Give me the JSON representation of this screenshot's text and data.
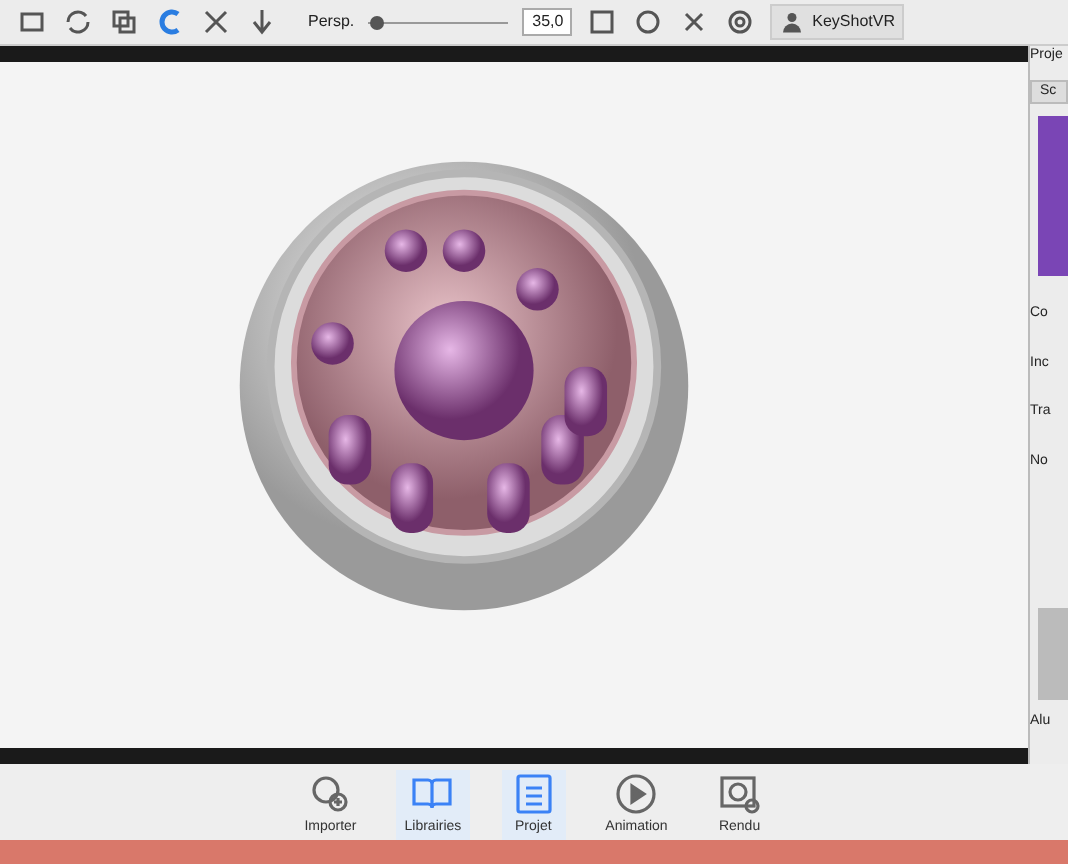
{
  "toolbar": {
    "perspective_label": "Persp.",
    "perspective_slider": {
      "level": 0.05
    },
    "perspective_value": "35,0",
    "vr_button": "KeyShotVR"
  },
  "side_panel": {
    "title": "Proje",
    "tab": "Sc",
    "labels": [
      "Co",
      "Inc",
      "Tra",
      "No"
    ],
    "material_label": "Alu"
  },
  "dock": [
    {
      "label": "Importer",
      "active": false
    },
    {
      "label": "Librairies",
      "active": true
    },
    {
      "label": "Projet",
      "active": true
    },
    {
      "label": "Animation",
      "active": false
    },
    {
      "label": "Rendu",
      "active": false
    }
  ]
}
